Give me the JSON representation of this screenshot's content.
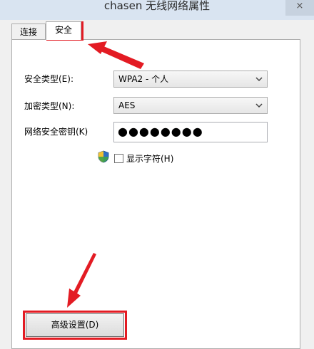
{
  "window": {
    "title": "chasen 无线网络属性",
    "close_glyph": "×"
  },
  "tabs": [
    {
      "label": "连接",
      "selected": false
    },
    {
      "label": "安全",
      "selected": true
    }
  ],
  "form": {
    "security_type_label": "安全类型(E):",
    "security_type_value": "WPA2 - 个人",
    "encryption_type_label": "加密类型(N):",
    "encryption_type_value": "AES",
    "key_label": "网络安全密钥(K)",
    "key_value": "●●●●●●●●",
    "show_chars_label": "显示字符(H)",
    "show_chars_checked": false
  },
  "advanced_button": {
    "label": "高级设置(D)"
  },
  "colors": {
    "highlight": "#e31b23",
    "titlebar": "#d9e4f1"
  },
  "icons": [
    "shield-icon",
    "chevron-down-icon",
    "close-icon",
    "annotation-arrow"
  ]
}
